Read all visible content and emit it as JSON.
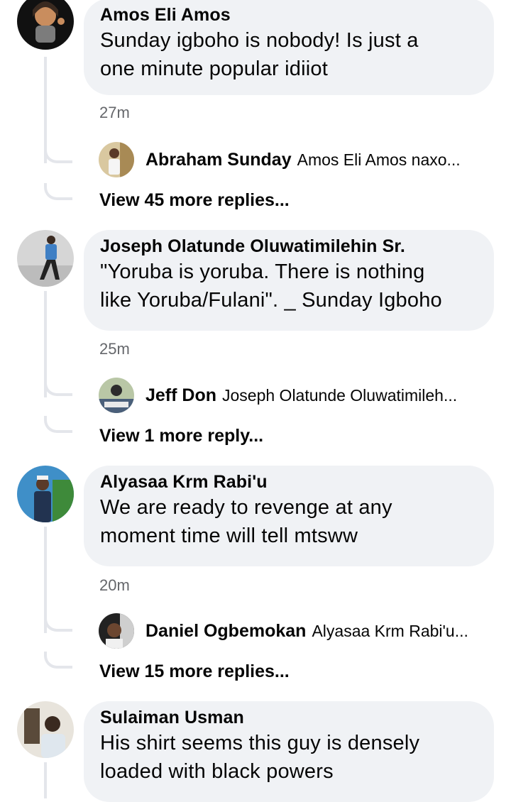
{
  "threads": [
    {
      "author": "Amos Eli Amos",
      "text_line1": "Sunday igboho is nobody! Is just a",
      "text_line2": "one minute popular idiiot",
      "time": "27m",
      "reply_author": "Abraham Sunday",
      "reply_preview": "Amos Eli Amos naxo...",
      "view_more": "View 45 more replies..."
    },
    {
      "author": "Joseph Olatunde Oluwatimilehin Sr.",
      "text_line1": "\"Yoruba is yoruba. There is nothing",
      "text_line2": "like Yoruba/Fulani\". _ Sunday Igboho",
      "time": "25m",
      "reply_author": "Jeff Don",
      "reply_preview": "Joseph Olatunde Oluwatimileh...",
      "view_more": "View 1 more reply..."
    },
    {
      "author": "Alyasaa Krm Rabi'u",
      "text_line1": "We are ready to revenge at any",
      "text_line2": "moment time will tell mtsww",
      "time": "20m",
      "reply_author": "Daniel Ogbemokan",
      "reply_preview": "Alyasaa Krm Rabi'u...",
      "view_more": "View 15 more replies..."
    },
    {
      "author": "Sulaiman Usman",
      "text_line1": "His shirt seems this guy is densely",
      "text_line2": "loaded with black powers"
    }
  ],
  "colors": {
    "bubble": "#f0f2f5",
    "thread_line": "#e4e6eb",
    "meta_text": "#65676b",
    "text": "#050505"
  },
  "icons": [
    "profile-avatar",
    "reply-avatar"
  ]
}
